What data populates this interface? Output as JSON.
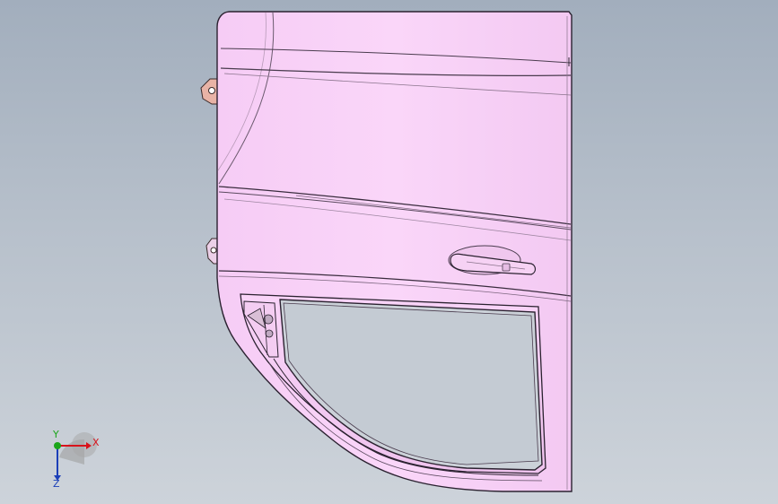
{
  "viewport": {
    "background_top": "#a2aebd",
    "background_bottom": "#cdd3da"
  },
  "model": {
    "part": "sliding-door-panel",
    "panel_color": "#f9d3f8",
    "edge_color": "#2b2230",
    "handle_color": "#f2c8ef"
  },
  "triad": {
    "x_label": "X",
    "y_label": "Y",
    "z_label": "Z",
    "x_color": "#d8131b",
    "y_color": "#1aa51a",
    "z_color": "#1b3fb8"
  }
}
